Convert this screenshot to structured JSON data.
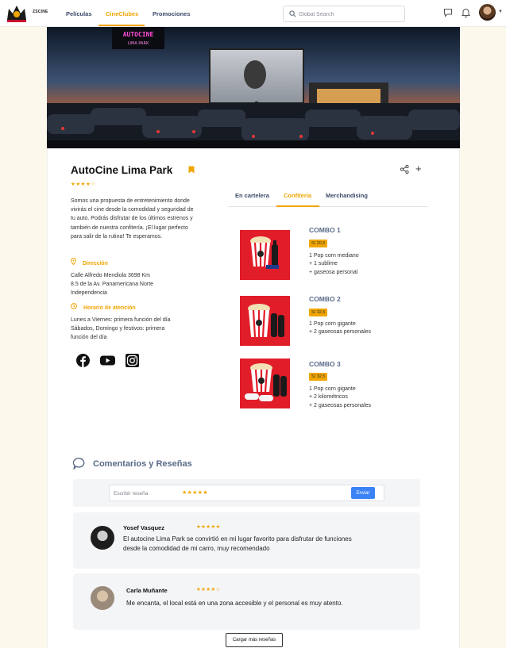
{
  "app": {
    "brand": "ZSCINE"
  },
  "nav": [
    {
      "label": "Películas"
    },
    {
      "label": "CineClubes"
    },
    {
      "label": "Promociones"
    }
  ],
  "search": {
    "placeholder": "Global Search"
  },
  "banner": {
    "sign_top": "AUTOCINE",
    "sign_bottom": "LIMA PARK"
  },
  "venue": {
    "name": "AutoCine Lima Park",
    "rating_stars": "★★★★☆",
    "description": "Somos una propuesta de entretenimiento donde vivirás el cine desde la comodidad y seguridad de tu auto. Podrás disfrutar de los últimos estrenos y también de nuestra confitería. ¡El lugar perfecto para salir de la rutina! Te esperamos.",
    "address_label": "Dirección",
    "address_lines": [
      "Calle Alfredo Mendiola 3698 Km",
      "8.5 de la Av. Panamericana Norte",
      "Independencia"
    ],
    "hours_label": "Horario de atención",
    "hours_lines": [
      "Lunes a Viernes: primera función del día",
      "Sábados, Domingo y festivos: primera",
      "función del día"
    ]
  },
  "socials": [
    "facebook-icon",
    "youtube-icon",
    "instagram-icon"
  ],
  "tabs": [
    {
      "label": "En cartelera"
    },
    {
      "label": "Confitería"
    },
    {
      "label": "Merchandising"
    }
  ],
  "combos": [
    {
      "title": "COMBO 1",
      "price": "S/ 20,5",
      "lines": [
        "1 Pop corn mediano",
        "+ 1 sublime",
        "+ gaseosa personal"
      ]
    },
    {
      "title": "COMBO 2",
      "price": "S/ 32,5",
      "lines": [
        "1 Pop corn gigante",
        "+ 2 gaseosas personales"
      ]
    },
    {
      "title": "COMBO 3",
      "price": "S/ 32,5",
      "lines": [
        "1 Pop corn gigante",
        "+ 2 kilométricos",
        "+ 2 gaseosas personales"
      ]
    }
  ],
  "reviews": {
    "title": "Comentarios y Reseñas",
    "input_placeholder": "Escribir reseña",
    "input_stars": "★★★★★",
    "send_label": "Enviar",
    "items": [
      {
        "name": "Yosef Vasquez",
        "stars": "★★★★★",
        "text_lines": [
          "El autocine Lima Park se convirtió en mi lugar favorito para disfrutar de funciones",
          "desde la comodidad de mi carro, muy recomendado"
        ]
      },
      {
        "name": "Carla Muñante",
        "stars": "★★★★☆",
        "text_lines": [
          "Me encanta, el local está en una zona accesible y el personal es muy atento."
        ]
      }
    ],
    "more_label": "Cargar más reseñas"
  },
  "colors": {
    "accent": "#f0a500",
    "nav_text": "#3b4a6b",
    "combo_bg": "#e11d2a",
    "send_button": "#3b82f6"
  }
}
